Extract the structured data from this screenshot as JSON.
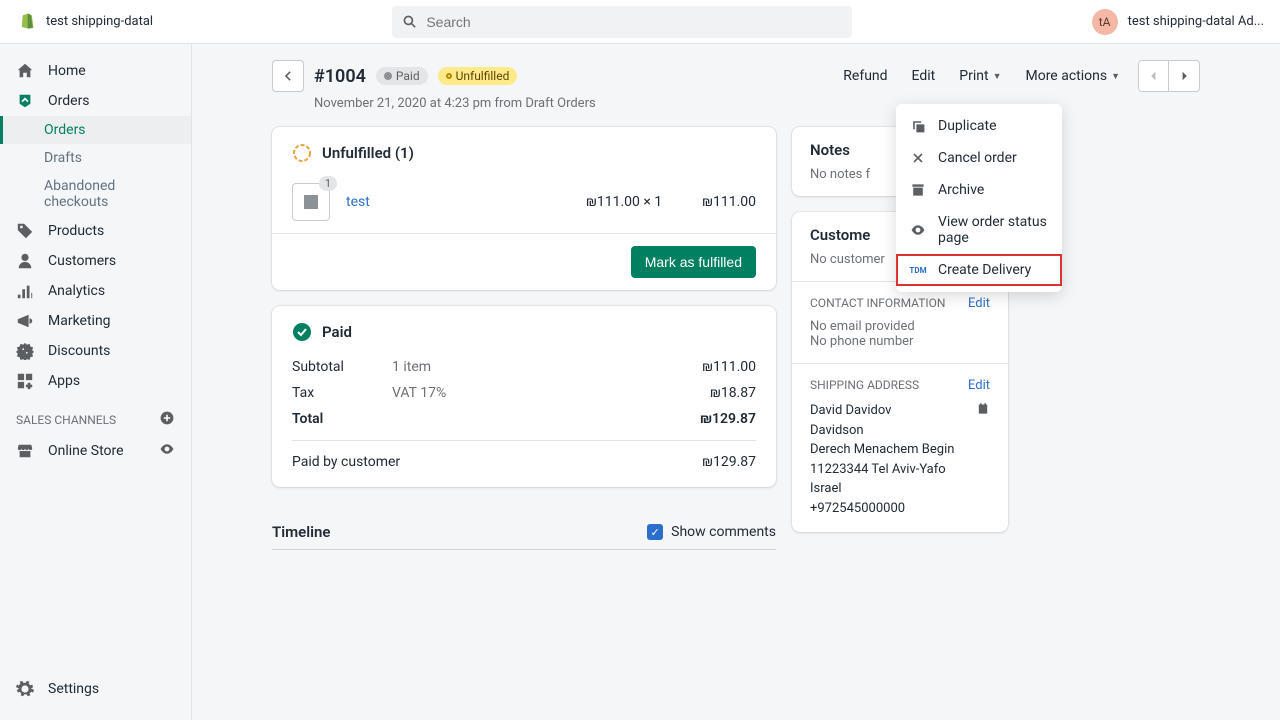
{
  "topbar": {
    "store": "test shipping-datal",
    "search_placeholder": "Search",
    "avatar_initials": "tA",
    "user": "test shipping-datal Ad..."
  },
  "sidebar": {
    "home": "Home",
    "orders": "Orders",
    "orders_sub": "Orders",
    "drafts": "Drafts",
    "abandoned": "Abandoned checkouts",
    "products": "Products",
    "customers": "Customers",
    "analytics": "Analytics",
    "marketing": "Marketing",
    "discounts": "Discounts",
    "apps": "Apps",
    "sales_channels": "SALES CHANNELS",
    "online_store": "Online Store",
    "settings": "Settings"
  },
  "order": {
    "title": "#1004",
    "paid_badge": "Paid",
    "unfulfilled_badge": "Unfulfilled",
    "refund": "Refund",
    "edit": "Edit",
    "print": "Print",
    "more_actions": "More actions",
    "meta": "November 21, 2020 at 4:23 pm from Draft Orders"
  },
  "dropdown": {
    "duplicate": "Duplicate",
    "cancel": "Cancel order",
    "archive": "Archive",
    "view_status": "View order status page",
    "create_delivery": "Create Delivery"
  },
  "unfulfilled": {
    "title": "Unfulfilled (1)",
    "item_count": "1",
    "item_name": "test",
    "price_each": "₪111.00 × 1",
    "line_total": "₪111.00",
    "mark_fulfilled": "Mark as fulfilled"
  },
  "paid": {
    "title": "Paid",
    "subtotal_label": "Subtotal",
    "subtotal_mid": "1 item",
    "subtotal_val": "₪111.00",
    "tax_label": "Tax",
    "tax_mid": "VAT 17%",
    "tax_val": "₪18.87",
    "total_label": "Total",
    "total_val": "₪129.87",
    "paid_by_label": "Paid by customer",
    "paid_by_val": "₪129.87"
  },
  "notes": {
    "title": "Notes",
    "none": "No notes f"
  },
  "customer": {
    "title": "Custome",
    "none": "No customer"
  },
  "contact": {
    "title": "CONTACT INFORMATION",
    "edit": "Edit",
    "no_email": "No email provided",
    "no_phone": "No phone number"
  },
  "shipping": {
    "title": "SHIPPING ADDRESS",
    "edit": "Edit",
    "line1": "David Davidov",
    "line2": "Davidson",
    "line3": "Derech Menachem Begin",
    "line4": "11223344 Tel Aviv-Yafo",
    "line5": "Israel",
    "line6": "+972545000000"
  },
  "timeline": {
    "title": "Timeline",
    "show_comments": "Show comments"
  }
}
